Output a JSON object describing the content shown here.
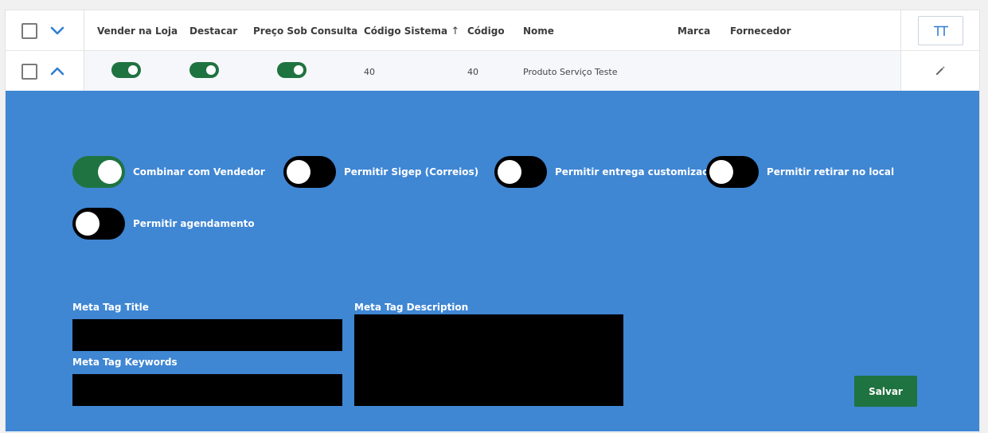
{
  "table": {
    "columns": {
      "vender_na_loja": "Vender na Loja",
      "destacar": "Destacar",
      "preco_sob_consulta": "Preço Sob Consulta",
      "codigo_sistema": "Código Sistema",
      "codigo": "Código",
      "nome": "Nome",
      "marca": "Marca",
      "fornecedor": "Fornecedor"
    },
    "sort_indicator": "↑",
    "row": {
      "vender_na_loja": true,
      "destacar": true,
      "preco_sob_consulta": true,
      "codigo_sistema": "40",
      "codigo": "40",
      "nome": "Produto Serviço Teste",
      "marca": "",
      "fornecedor": ""
    }
  },
  "panel": {
    "toggles": [
      {
        "label": "Combinar com Vendedor",
        "on": true
      },
      {
        "label": "Permitir Sigep (Correios)",
        "on": false
      },
      {
        "label": "Permitir entrega customizada",
        "on": false
      },
      {
        "label": "Permitir retirar no local",
        "on": false
      },
      {
        "label": "Permitir agendamento",
        "on": false
      }
    ],
    "meta_title_label": "Meta Tag Title",
    "meta_title_value": "",
    "meta_keywords_label": "Meta Tag Keywords",
    "meta_keywords_value": "",
    "meta_description_label": "Meta Tag Description",
    "meta_description_value": "",
    "save_label": "Salvar"
  },
  "colors": {
    "panel_bg": "#3f86d3",
    "toggle_on": "#1f7340",
    "toggle_off": "#000000",
    "save_button": "#1f7340",
    "accent_blue": "#2f7fd1"
  },
  "icons": {
    "header_expand": "chevron-down-icon",
    "row_collapse": "chevron-up-icon",
    "columns": "columns-icon",
    "edit": "pencil-icon"
  }
}
